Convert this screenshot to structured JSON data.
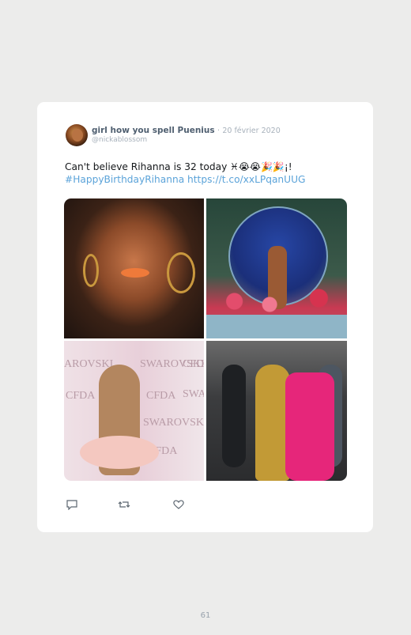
{
  "tweet": {
    "display_name": "girl how you spell Puenius",
    "separator": "·",
    "date": "20 février 2020",
    "handle": "@nickablossom",
    "text": "Can't believe Rihanna is 32 today",
    "emojis": "♓😭😭🎉🎉",
    "suffix": "¡!",
    "hashtag": "#HappyBirthdayRihanna",
    "link": "https://t.co/xxLPqanUUG"
  },
  "actions": [
    {
      "icon": "reply-icon"
    },
    {
      "icon": "retweet-icon"
    },
    {
      "icon": "like-icon"
    }
  ],
  "photo_text": {
    "sponsor_words": [
      "AROVSKI",
      "SWAROVSKI",
      "CFDA",
      "CFDA",
      "SWARO",
      "CFDA",
      "SWAROVSKI",
      "CFDA"
    ]
  },
  "page_number": "61",
  "colors": {
    "background": "#ececeb",
    "card": "#ffffff",
    "link": "#5ba3d9",
    "muted": "#a7b1bb",
    "name": "#4f5f70"
  }
}
